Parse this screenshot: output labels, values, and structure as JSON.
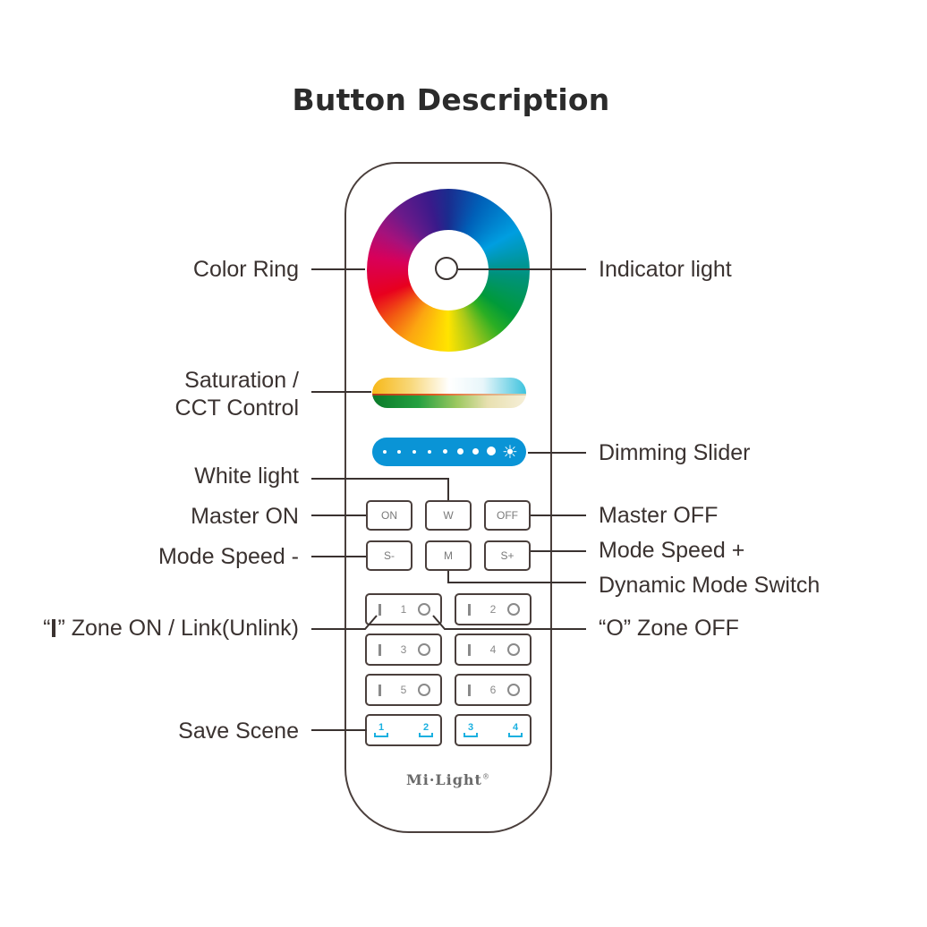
{
  "title": "Button Description",
  "remote": {
    "brand": "Mi·Light",
    "brand_mark": "®",
    "buttons": {
      "on": "ON",
      "white": "W",
      "off": "OFF",
      "speed_minus": "S-",
      "mode": "M",
      "speed_plus": "S+"
    },
    "zones": [
      "1",
      "2",
      "3",
      "4",
      "5",
      "6"
    ],
    "scenes": [
      "1",
      "2",
      "3",
      "4"
    ],
    "dimmer_steps": 8
  },
  "labels": {
    "left": {
      "color_ring": "Color Ring",
      "saturation_line1": "Saturation /",
      "saturation_line2": "CCT Control",
      "white_light": "White light",
      "master_on": "Master ON",
      "mode_speed_minus": "Mode Speed -",
      "zone_on_quote_open": "“",
      "zone_on_quote_close": "”",
      "zone_on": "Zone ON / Link(Unlink)",
      "save_scene": "Save Scene"
    },
    "right": {
      "indicator_light": "Indicator light",
      "dimming_slider": "Dimming Slider",
      "master_off": "Master OFF",
      "mode_speed_plus": "Mode Speed +",
      "dynamic_mode_switch": "Dynamic Mode Switch",
      "zone_off": "“O” Zone OFF"
    }
  },
  "colors": {
    "outline": "#4a3f3c",
    "text": "#3a3230",
    "dimmer": "#0a94d6",
    "scene_accent": "#1ab0e0"
  }
}
